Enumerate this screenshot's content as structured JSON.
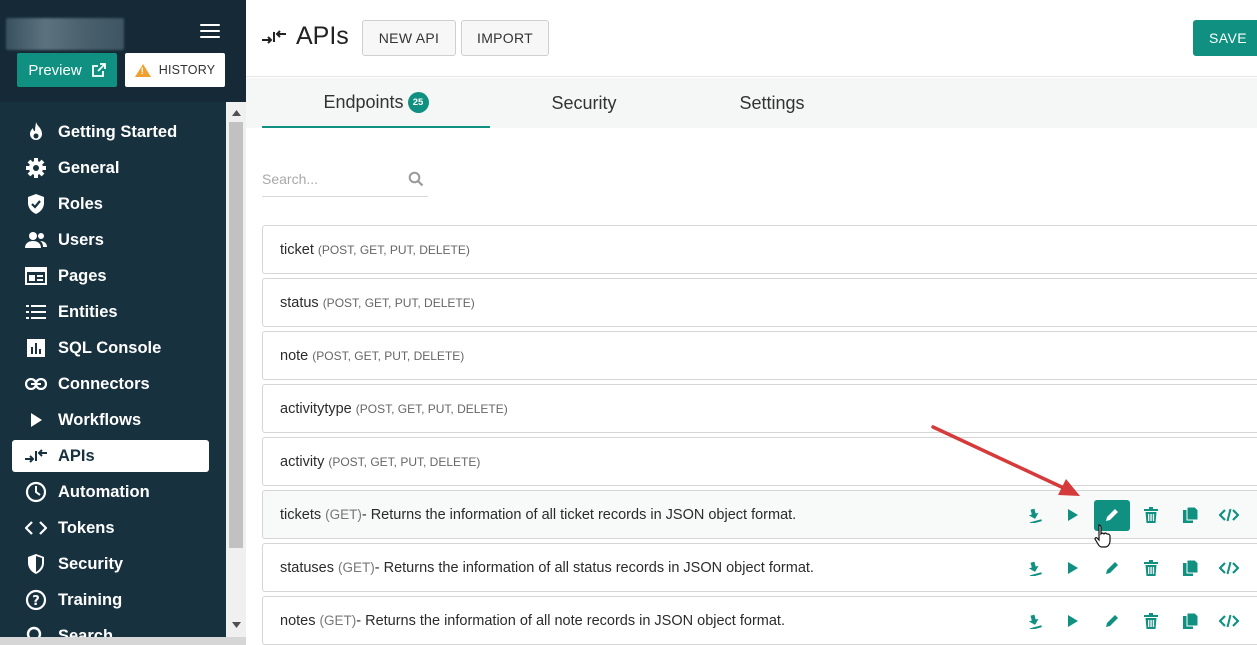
{
  "sidebar": {
    "preview_label": "Preview",
    "history_label": "HISTORY",
    "items": [
      {
        "label": "Getting Started",
        "icon": "fire-icon"
      },
      {
        "label": "General",
        "icon": "gear-icon"
      },
      {
        "label": "Roles",
        "icon": "shield-check-icon"
      },
      {
        "label": "Users",
        "icon": "users-icon"
      },
      {
        "label": "Pages",
        "icon": "pages-icon"
      },
      {
        "label": "Entities",
        "icon": "list-icon"
      },
      {
        "label": "SQL Console",
        "icon": "chart-icon"
      },
      {
        "label": "Connectors",
        "icon": "link-icon"
      },
      {
        "label": "Workflows",
        "icon": "play-icon"
      },
      {
        "label": "APIs",
        "icon": "api-arrows-icon"
      },
      {
        "label": "Automation",
        "icon": "clock-icon"
      },
      {
        "label": "Tokens",
        "icon": "code-brackets-icon"
      },
      {
        "label": "Security",
        "icon": "security-shield-icon"
      },
      {
        "label": "Training",
        "icon": "question-icon"
      },
      {
        "label": "Search",
        "icon": "search-icon"
      }
    ],
    "active_item": "APIs"
  },
  "header": {
    "title": "APIs",
    "new_api_label": "NEW API",
    "import_label": "IMPORT",
    "save_label": "SAVE"
  },
  "tabs": [
    {
      "label": "Endpoints",
      "badge": "25"
    },
    {
      "label": "Security"
    },
    {
      "label": "Settings"
    }
  ],
  "search": {
    "placeholder": "Search..."
  },
  "endpoints": [
    {
      "name": "ticket",
      "methods": "(POST, GET, PUT, DELETE)"
    },
    {
      "name": "status",
      "methods": "(POST, GET, PUT, DELETE)"
    },
    {
      "name": "note",
      "methods": "(POST, GET, PUT, DELETE)"
    },
    {
      "name": "activitytype",
      "methods": "(POST, GET, PUT, DELETE)"
    },
    {
      "name": "activity",
      "methods": "(POST, GET, PUT, DELETE)"
    },
    {
      "name": "tickets",
      "methods": "(GET)",
      "description": "- Returns the information of all ticket records in JSON object format."
    },
    {
      "name": "statuses",
      "methods": "(GET)",
      "description": "- Returns the information of all status records in JSON object format."
    },
    {
      "name": "notes",
      "methods": "(GET)",
      "description": "- Returns the information of all note records in JSON object format."
    }
  ],
  "colors": {
    "accent": "#0f9080",
    "sidebar_bg": "#17313f",
    "annotation_arrow": "#d63b3b"
  }
}
